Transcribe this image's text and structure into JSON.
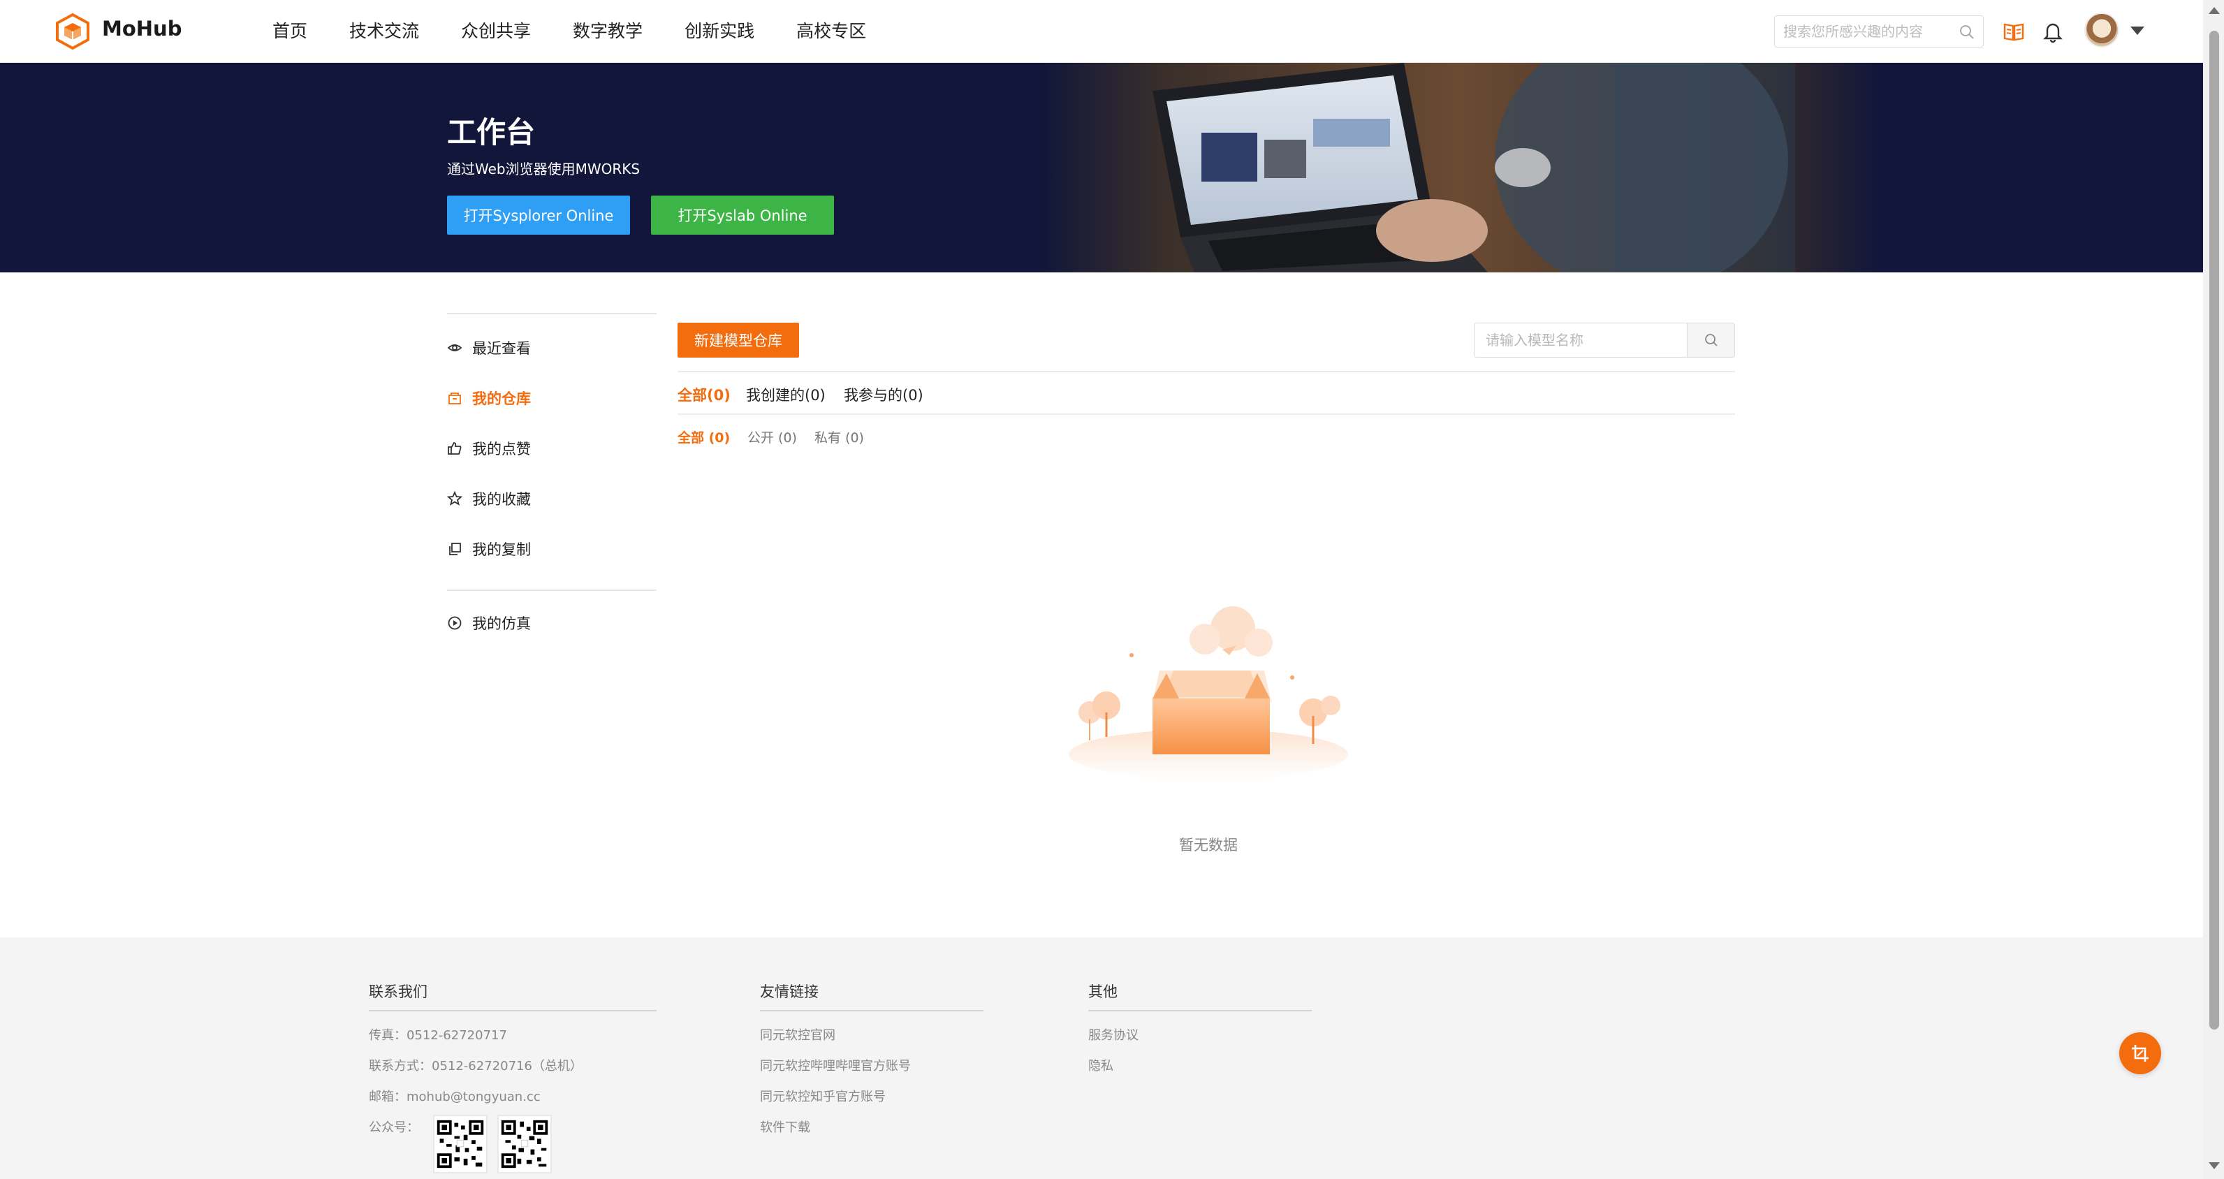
{
  "header": {
    "brand": "MoHub",
    "nav": [
      "首页",
      "技术交流",
      "众创共享",
      "数字教学",
      "创新实践",
      "高校专区"
    ],
    "search_placeholder": "搜索您所感兴趣的内容"
  },
  "banner": {
    "title": "工作台",
    "subtitle": "通过Web浏览器使用MWORKS",
    "btn_sysplorer": "打开Sysplorer Online",
    "btn_syslab": "打开Syslab Online"
  },
  "sidebar": {
    "items": [
      {
        "label": "最近查看",
        "icon": "eye-icon",
        "active": false
      },
      {
        "label": "我的仓库",
        "icon": "repo-icon",
        "active": true
      },
      {
        "label": "我的点赞",
        "icon": "thumbs-up-icon",
        "active": false
      },
      {
        "label": "我的收藏",
        "icon": "star-icon",
        "active": false
      },
      {
        "label": "我的复制",
        "icon": "copy-icon",
        "active": false
      },
      {
        "label": "我的仿真",
        "icon": "play-circle-icon",
        "active": false
      }
    ]
  },
  "main": {
    "new_repo_label": "新建模型仓库",
    "model_search_placeholder": "请输入模型名称",
    "tabs": [
      "全部(0)",
      "我创建的(0)",
      "我参与的(0)"
    ],
    "subtabs": [
      "全部 (0)",
      "公开 (0)",
      "私有 (0)"
    ],
    "empty_text": "暂无数据"
  },
  "footer": {
    "contact": {
      "title": "联系我们",
      "fax": "传真：0512-62720717",
      "phone": "联系方式：0512-62720716（总机）",
      "email": "邮箱：mohub@tongyuan.cc",
      "wechat_label": "公众号："
    },
    "links": {
      "title": "友情链接",
      "items": [
        "同元软控官网",
        "同元软控哔哩哔哩官方账号",
        "同元软控知乎官方账号",
        "软件下载"
      ]
    },
    "other": {
      "title": "其他",
      "items": [
        "服务协议",
        "隐私"
      ]
    }
  },
  "colors": {
    "accent": "#f36d0f",
    "banner_bg": "#11163a",
    "sysplorer_blue": "#2f9ff5",
    "syslab_green": "#3db446",
    "footer_bg": "#f4f4f4"
  }
}
